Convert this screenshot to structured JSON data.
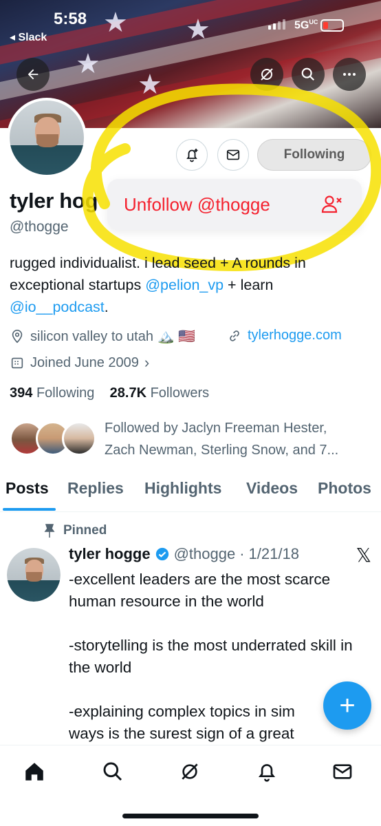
{
  "status_bar": {
    "time": "5:58",
    "back_app": "◂ Slack",
    "network": "5G",
    "network_suffix": "UC",
    "battery_color": "#ff3b30"
  },
  "header_icons": {
    "back": "back-arrow-icon",
    "grok": "grok-icon",
    "search": "search-icon",
    "more": "more-icon"
  },
  "profile_actions": {
    "notify_icon": "bell-plus-icon",
    "message_icon": "mail-icon",
    "following_label": "Following"
  },
  "profile": {
    "name": "tyler hog",
    "handle": "@thogge",
    "bio_prefix": "rugged individualist. i lead seed + A rounds in exceptional startups ",
    "bio_mention_1": "@pelion_vp",
    "bio_middle": " + learn ",
    "bio_mention_2": "@io__podcast",
    "bio_suffix": ".",
    "location": "silicon valley to utah 🏔️ 🇺🇸",
    "website": "tylerhogge.com",
    "joined": "Joined June 2009",
    "following_count": "394",
    "following_label": "Following",
    "followers_count": "28.7K",
    "followers_label": "Followers",
    "followed_by_line1": "Followed by Jaclyn Freeman Hester,",
    "followed_by_line2": "Zach Newman, Sterling Snow, and 7..."
  },
  "unfollow_menu": {
    "label": "Unfollow @thogge",
    "icon": "person-remove-icon",
    "color": "#f4212e"
  },
  "tabs": [
    {
      "label": "Posts",
      "active": true
    },
    {
      "label": "Replies"
    },
    {
      "label": "Highlights"
    },
    {
      "label": "Videos"
    },
    {
      "label": "Photos"
    }
  ],
  "pinned_post": {
    "pinned_label": "Pinned",
    "author_name": "tyler hogge",
    "author_handle": "@thogge",
    "separator": "·",
    "date": "1/21/18",
    "text": "-excellent leaders are the most scarce human resource in the world\n\n-storytelling is the most underrated skill in the world\n\n-explaining complex topics in sim\nways is the surest sign of a great"
  },
  "fab": {
    "label": "+"
  },
  "bottom_nav": [
    "home-icon",
    "search-icon",
    "grok-icon",
    "notifications-icon",
    "messages-icon"
  ],
  "colors": {
    "accent": "#1d9bf0",
    "highlight": "#f7e000",
    "danger": "#f4212e"
  }
}
